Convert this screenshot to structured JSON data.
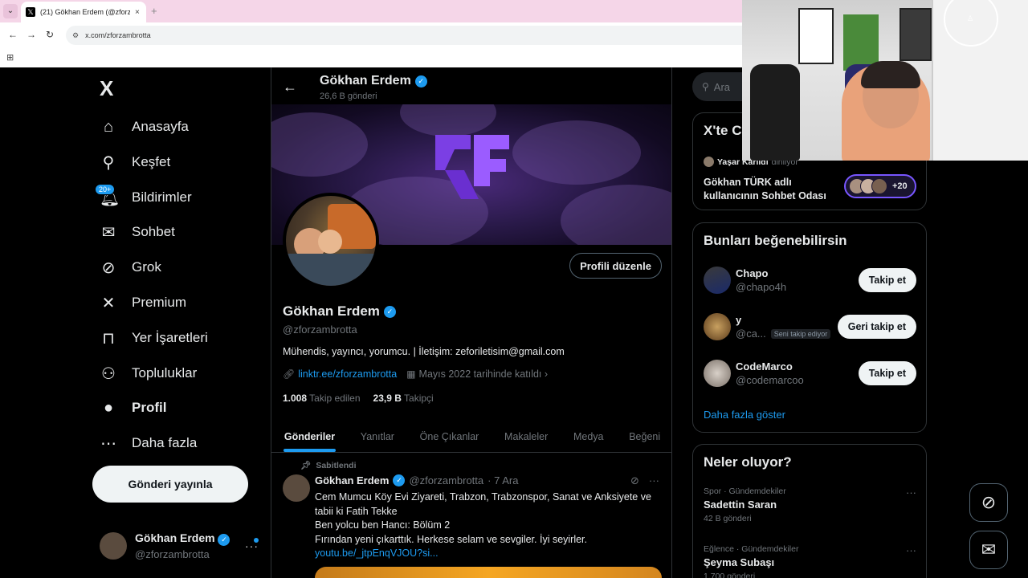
{
  "browser": {
    "tab_title": "(21) Gökhan Erdem (@zforzamb",
    "url": "x.com/zforzambrotta",
    "new_tab": "+",
    "close": "×"
  },
  "sidebar": {
    "logo": "X",
    "items": [
      {
        "label": "Anasayfa",
        "icon": "home-icon",
        "glyph": "⌂"
      },
      {
        "label": "Keşfet",
        "icon": "search-icon",
        "glyph": "⚲"
      },
      {
        "label": "Bildirimler",
        "icon": "bell-icon",
        "glyph": "🔔︎"
      },
      {
        "label": "Sohbet",
        "icon": "mail-icon",
        "glyph": "✉"
      },
      {
        "label": "Grok",
        "icon": "grok-icon",
        "glyph": "⊘"
      },
      {
        "label": "Premium",
        "icon": "x-icon",
        "glyph": "✕"
      },
      {
        "label": "Yer İşaretleri",
        "icon": "bookmark-icon",
        "glyph": "⊓"
      },
      {
        "label": "Topluluklar",
        "icon": "communities-icon",
        "glyph": "⚇"
      },
      {
        "label": "Profil",
        "icon": "profile-icon",
        "glyph": "●"
      },
      {
        "label": "Daha fazla",
        "icon": "more-icon",
        "glyph": "⋯"
      }
    ],
    "badge": "20+",
    "post_button": "Gönderi yayınla",
    "me": {
      "name": "Gökhan Erdem",
      "handle": "@zforzambrotta",
      "more": "···"
    }
  },
  "profile": {
    "header_name": "Gökhan Erdem",
    "header_posts": "26,6 B gönderi",
    "edit_button": "Profili düzenle",
    "name": "Gökhan Erdem",
    "handle": "@zforzambrotta",
    "bio": "Mühendis, yayıncı, yorumcu. | İletişim: zeforiletisim@gmail.com",
    "link": "linktr.ee/zforzambrotta",
    "joined": "Mayıs 2022 tarihinde katıldı",
    "following_count": "1.008",
    "following_label": "Takip edilen",
    "followers_count": "23,9 B",
    "followers_label": "Takipçi",
    "tabs": [
      "Gönderiler",
      "Yanıtlar",
      "Öne Çıkanlar",
      "Makaleler",
      "Medya",
      "Beğeni"
    ]
  },
  "tweet": {
    "pinned_label": "Sabitlendi",
    "name": "Gökhan Erdem",
    "handle": "@zforzambrotta",
    "date": "· 7 Ara",
    "lines": [
      "Cem Mumcu Köy Evi Ziyareti, Trabzon, Trabzonspor, Sanat ve Anksiyete ve",
      "tabii ki Fatih Tekke",
      "Ben yolcu ben Hancı: Bölüm 2",
      "Fırından yeni çıkarttık. Herkese selam ve sevgiler. İyi seyirler.",
      "youtu.be/_jtpEnqVJOU?si..."
    ]
  },
  "right": {
    "search_placeholder": "Ara",
    "spaces_title": "X'te C",
    "space_host": "Yaşar Karlıdı",
    "space_host_suffix": "dinliyor",
    "space_title": "Gökhan TÜRK adlı kullanıcının Sohbet Odası",
    "space_count": "+20",
    "wtf_title": "Bunları beğenebilirsin",
    "suggestions": [
      {
        "name": "Chapo",
        "handle": "@chapo4h",
        "button": "Takip et",
        "follows_you": ""
      },
      {
        "name": "y",
        "handle": "@ca...",
        "button": "Geri takip et",
        "follows_you": "Seni takip ediyor"
      },
      {
        "name": "CodeMarco",
        "handle": "@codemarcoo",
        "button": "Takip et",
        "follows_you": ""
      }
    ],
    "show_more": "Daha fazla göster",
    "trends_title": "Neler oluyor?",
    "trends": [
      {
        "category": "Spor · Gündemdekiler",
        "name": "Sadettin Saran",
        "count": "42 B gönderi"
      },
      {
        "category": "Eğlence · Gündemdekiler",
        "name": "Şeyma Subaşı",
        "count": "1.700 gönderi"
      }
    ]
  },
  "colors": {
    "accent": "#1d9bf0",
    "background": "#000000",
    "border": "#2f3336",
    "muted": "#71767b",
    "tab_bar": "#f5d6e8"
  }
}
